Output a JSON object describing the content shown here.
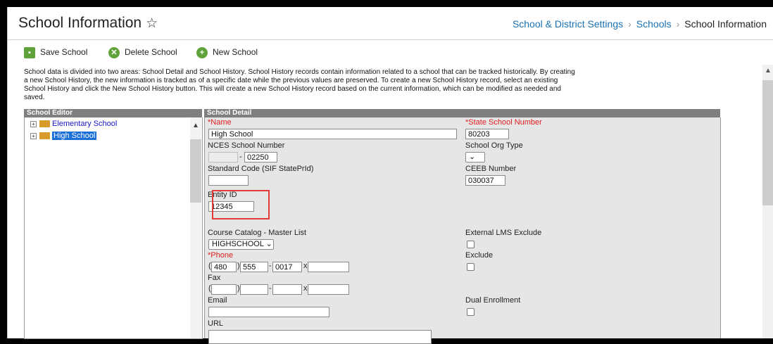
{
  "header": {
    "title": "School Information",
    "breadcrumb": [
      "School & District Settings",
      "Schools",
      "School Information"
    ]
  },
  "toolbar": {
    "save": "Save School",
    "delete": "Delete School",
    "new": "New School"
  },
  "description": "School data is divided into two areas: School Detail and School History. School History records contain information related to a school that can be tracked historically. By creating a new School History, the new information is tracked as of a specific date while the previous values are preserved. To create a new School History record, select an existing School History and click the New School History button. This will create a new School History record based on the current information, which can be modified as needed and saved.",
  "editor": {
    "heading": "School Editor",
    "items": [
      "Elementary School",
      "High School"
    ]
  },
  "detail": {
    "heading": "School Detail",
    "name_label": "*Name",
    "name_value": "High School",
    "state_num_label": "*State School Number",
    "state_num_value": "80203",
    "nces_label": "NCES School Number",
    "nces_value": "02250",
    "org_type_label": "School Org Type",
    "standard_code_label": "Standard Code (SIF StatePrId)",
    "ceeb_label": "CEEB Number",
    "ceeb_value": "030037",
    "entity_label": "Entity ID",
    "entity_value": "12345",
    "catalog_label": "Course Catalog - Master List",
    "catalog_value": "HIGHSCHOOL",
    "lms_label": "External LMS Exclude",
    "phone_label": "*Phone",
    "phone_area": "480",
    "phone_prefix": "555",
    "phone_line": "0017",
    "exclude_label": "Exclude",
    "fax_label": "Fax",
    "email_label": "Email",
    "dual_label": "Dual Enrollment",
    "url_label": "URL"
  },
  "colors": {
    "link": "#1a73b5",
    "required": "#e01e1e",
    "highlight": "#e23b3b",
    "toolbar_icon": "#5fa33a",
    "panel_header": "#7f7f7f"
  }
}
